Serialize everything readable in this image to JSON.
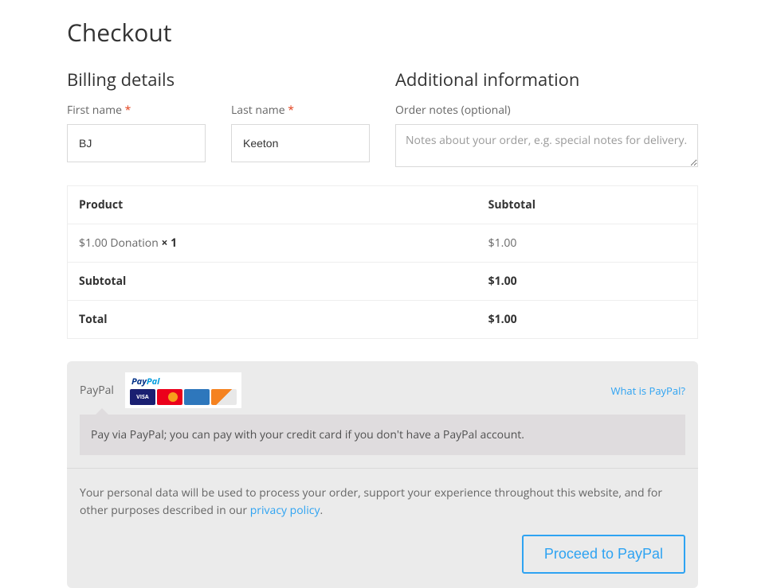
{
  "page_title": "Checkout",
  "billing": {
    "heading": "Billing details",
    "first_name_label": "First name",
    "first_name_value": "BJ",
    "last_name_label": "Last name",
    "last_name_value": "Keeton"
  },
  "additional": {
    "heading": "Additional information",
    "notes_label": "Order notes (optional)",
    "notes_placeholder": "Notes about your order, e.g. special notes for delivery."
  },
  "order_table": {
    "col_product": "Product",
    "col_subtotal": "Subtotal",
    "item_name": "$1.00 Donation ",
    "item_qty": " × 1",
    "item_subtotal": "$1.00",
    "subtotal_label": "Subtotal",
    "subtotal_value": "$1.00",
    "total_label": "Total",
    "total_value": "$1.00"
  },
  "payment": {
    "method_label": "PayPal",
    "what_link": "What is PayPal?",
    "description": "Pay via PayPal; you can pay with your credit card if you don't have a PayPal account.",
    "privacy_text_a": "Your personal data will be used to process your order, support your experience throughout this website, and for other purposes described in our ",
    "privacy_link": "privacy policy",
    "privacy_text_b": ".",
    "proceed_button": "Proceed to PayPal"
  }
}
